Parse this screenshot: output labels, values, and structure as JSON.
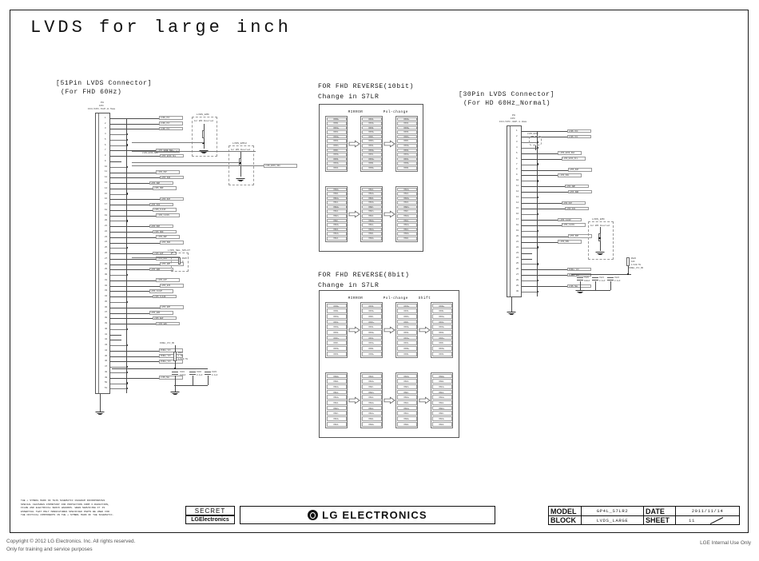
{
  "sheet": {
    "title": "LVDS for large inch"
  },
  "connector_left": {
    "heading_line1": "[51Pin LVDS Connector]",
    "heading_line2": "(For FHD 60Hz)",
    "ref": "P8",
    "part": "FPC",
    "desc": "FFC/FPC-51P-0.5mm",
    "pin_count": 51,
    "pins": [
      {
        "num": "1",
        "net": "LVDS_VCC"
      },
      {
        "num": "2",
        "net": "LVDS_VCC"
      },
      {
        "num": "3",
        "net": "LVDS_VCC"
      },
      {
        "num": "4",
        "net": "GND"
      },
      {
        "num": "5",
        "net": "GND"
      },
      {
        "num": "6",
        "net": "GND"
      },
      {
        "num": "7",
        "net": "LVDS_EDID_SDA"
      },
      {
        "num": "8",
        "net": "LVDS_EDID_SCL"
      },
      {
        "num": "9",
        "net": "NC"
      },
      {
        "num": "10",
        "net": "GND"
      },
      {
        "num": "11",
        "net": "LVDS_OAP"
      },
      {
        "num": "12",
        "net": "LVDS_OAN"
      },
      {
        "num": "13",
        "net": "LVDS_OBP"
      },
      {
        "num": "14",
        "net": "LVDS_OBN"
      },
      {
        "num": "15",
        "net": "GND"
      },
      {
        "num": "16",
        "net": "LVDS_OCP"
      },
      {
        "num": "17",
        "net": "LVDS_OCN"
      },
      {
        "num": "18",
        "net": "LVDS_CLK1P"
      },
      {
        "num": "19",
        "net": "LVDS_CLK1N"
      },
      {
        "num": "20",
        "net": "GND"
      },
      {
        "num": "21",
        "net": "LVDS_ODP"
      },
      {
        "num": "22",
        "net": "LVDS_ODN"
      },
      {
        "num": "23",
        "net": "LVDS_OEP"
      },
      {
        "num": "24",
        "net": "LVDS_OEN"
      },
      {
        "num": "25",
        "net": "GND"
      },
      {
        "num": "26",
        "net": "LVDS_EAP"
      },
      {
        "num": "27",
        "net": "LVDS_EAN"
      },
      {
        "num": "28",
        "net": "LVDS_EBP"
      },
      {
        "num": "29",
        "net": "LVDS_EBN"
      },
      {
        "num": "30",
        "net": "GND"
      },
      {
        "num": "31",
        "net": "LVDS_ECP"
      },
      {
        "num": "32",
        "net": "LVDS_ECN"
      },
      {
        "num": "33",
        "net": "LVDS_CLK2P"
      },
      {
        "num": "34",
        "net": "LVDS_CLK2N"
      },
      {
        "num": "35",
        "net": "GND"
      },
      {
        "num": "36",
        "net": "LVDS_EDP"
      },
      {
        "num": "37",
        "net": "LVDS_EDN"
      },
      {
        "num": "38",
        "net": "LVDS_EEP"
      },
      {
        "num": "39",
        "net": "LVDS_EEN"
      },
      {
        "num": "40",
        "net": "GND"
      },
      {
        "num": "41",
        "net": "NC"
      },
      {
        "num": "42",
        "net": "NC"
      },
      {
        "num": "43",
        "net": "GND"
      },
      {
        "num": "44",
        "net": "PANEL_VCC"
      },
      {
        "num": "45",
        "net": "PANEL_VCC"
      },
      {
        "num": "46",
        "net": "PANEL_VCC"
      },
      {
        "num": "47",
        "net": "GND"
      },
      {
        "num": "48",
        "net": "GND"
      },
      {
        "num": "49",
        "net": "LVDS_SEL"
      },
      {
        "num": "50",
        "net": "GND"
      },
      {
        "num": "51",
        "net": "GND"
      }
    ]
  },
  "connector_right": {
    "heading_line1": "[30Pin LVDS Connector]",
    "heading_line2": "(For HD 60Hz_Normal)",
    "ref": "P9",
    "part": "FPC",
    "desc": "FFC/FPC-30P-1.0mm",
    "pin_count": 30,
    "pins": [
      {
        "num": "1",
        "net": "LVDS_VCC"
      },
      {
        "num": "2",
        "net": "LVDS_VCC"
      },
      {
        "num": "3",
        "net": "GND"
      },
      {
        "num": "4",
        "net": "GND"
      },
      {
        "num": "5",
        "net": "LVDS_EDID_SDA"
      },
      {
        "num": "6",
        "net": "LVDS_EDID_SCL"
      },
      {
        "num": "7",
        "net": "GND"
      },
      {
        "num": "8",
        "net": "LVDS_OAP"
      },
      {
        "num": "9",
        "net": "LVDS_OAN"
      },
      {
        "num": "10",
        "net": "GND"
      },
      {
        "num": "11",
        "net": "LVDS_OBP"
      },
      {
        "num": "12",
        "net": "LVDS_OBN"
      },
      {
        "num": "13",
        "net": "GND"
      },
      {
        "num": "14",
        "net": "LVDS_OCP"
      },
      {
        "num": "15",
        "net": "LVDS_OCN"
      },
      {
        "num": "16",
        "net": "GND"
      },
      {
        "num": "17",
        "net": "LVDS_CLK1P"
      },
      {
        "num": "18",
        "net": "LVDS_CLK1N"
      },
      {
        "num": "19",
        "net": "GND"
      },
      {
        "num": "20",
        "net": "LVDS_ODP"
      },
      {
        "num": "21",
        "net": "LVDS_ODN"
      },
      {
        "num": "22",
        "net": "GND"
      },
      {
        "num": "23",
        "net": "NC"
      },
      {
        "num": "24",
        "net": "NC"
      },
      {
        "num": "25",
        "net": "GND"
      },
      {
        "num": "26",
        "net": "PANEL_VCC"
      },
      {
        "num": "27",
        "net": "PANEL_VCC"
      },
      {
        "num": "28",
        "net": "GND"
      },
      {
        "num": "29",
        "net": "LVDS_SEL"
      },
      {
        "num": "30",
        "net": "GND"
      }
    ]
  },
  "opt_blocks": [
    {
      "label": "LVDS_EMI",
      "note": "For EMI Reserved"
    },
    {
      "label": "LVDS_EMI2",
      "note": "For EMI Reserved"
    },
    {
      "label": "LVDS_EMI",
      "note": "For EMI Reserved"
    }
  ],
  "components": {
    "left_cluster": {
      "resistor": {
        "ref": "R801",
        "value": "1.5K",
        "tol": "1/10W 5%",
        "net": "PANEL_VCC_ON"
      },
      "caps": [
        {
          "ref": "C801",
          "value": "100uF",
          "rating": "16V"
        },
        {
          "ref": "C802",
          "value": "0.1uF",
          "rating": "16V"
        },
        {
          "ref": "C803",
          "value": "0.1uF",
          "rating": "16V"
        }
      ],
      "gnd": "GND"
    },
    "mid_cluster": {
      "label": "LVDS_SEL_SPLIT",
      "resistor": {
        "ref": "R805",
        "value": "0",
        "tol": "1/16W"
      }
    },
    "right_cluster": {
      "resistor": {
        "ref": "R820",
        "value": "10K",
        "tol": "1/16W 5%",
        "net": "PANEL_VCC_ON"
      },
      "caps": [
        {
          "ref": "C820",
          "value": "100uF",
          "rating": "16V"
        },
        {
          "ref": "C821",
          "value": "0.1uF",
          "rating": "16V"
        },
        {
          "ref": "C822",
          "value": "0.1uF",
          "rating": "16V"
        }
      ],
      "gnd": "GND"
    }
  },
  "table_10bit": {
    "heading_line1": "FOR FHD REVERSE(10bit)",
    "heading_line2": "Change in S7LR",
    "col_labels": [
      "MIRROR",
      "Pol-change"
    ],
    "groups": [
      {
        "columns": [
          [
            "RXO0+",
            "RXO0-",
            "RXO1+",
            "RXO1-",
            "RXO2+",
            "RXO2-",
            "RXOC+",
            "RXOC-",
            "RXO3+",
            "RXO3-",
            "RXO4+",
            "RXO4-"
          ],
          [
            "RXO4-",
            "RXO4+",
            "RXO3-",
            "RXO3+",
            "RXOC-",
            "RXOC+",
            "RXO2-",
            "RXO2+",
            "RXO1-",
            "RXO1+",
            "RXO0-",
            "RXO0+"
          ],
          [
            "RXO4+",
            "RXO4-",
            "RXO3+",
            "RXO3-",
            "RXOC+",
            "RXOC-",
            "RXO2+",
            "RXO2-",
            "RXO1+",
            "RXO1-",
            "RXO0+",
            "RXO0-"
          ]
        ]
      },
      {
        "columns": [
          [
            "RXE0+",
            "RXE0-",
            "RXE1+",
            "RXE1-",
            "RXE2+",
            "RXE2-",
            "RXEC+",
            "RXEC-",
            "RXE3+",
            "RXE3-",
            "RXE4+",
            "RXE4-"
          ],
          [
            "RXE4-",
            "RXE4+",
            "RXE3-",
            "RXE3+",
            "RXEC-",
            "RXEC+",
            "RXE2-",
            "RXE2+",
            "RXE1-",
            "RXE1+",
            "RXE0-",
            "RXE0+"
          ],
          [
            "RXE4+",
            "RXE4-",
            "RXE3+",
            "RXE3-",
            "RXEC+",
            "RXEC-",
            "RXE2+",
            "RXE2-",
            "RXE1+",
            "RXE1-",
            "RXE0+",
            "RXE0-"
          ]
        ]
      }
    ]
  },
  "table_8bit": {
    "heading_line1": "FOR FHD REVERSE(8bit)",
    "heading_line2": "Change in S7LR",
    "col_labels": [
      "MIRROR",
      "Pol-change",
      "Shift"
    ],
    "groups": [
      {
        "columns": [
          [
            "RXO0+",
            "RXO0-",
            "RXO1+",
            "RXO1-",
            "RXO2+",
            "RXO2-",
            "RXOC+",
            "RXOC-",
            "RXO3+",
            "RXO3-"
          ],
          [
            "RXO3-",
            "RXO3+",
            "RXOC-",
            "RXOC+",
            "RXO2-",
            "RXO2+",
            "RXO1-",
            "RXO1+",
            "RXO0-",
            "RXO0+"
          ],
          [
            "RXO3+",
            "RXO3-",
            "RXOC+",
            "RXOC-",
            "RXO2+",
            "RXO2-",
            "RXO1+",
            "RXO1-",
            "RXO0+",
            "RXO0-"
          ],
          [
            "RXO0+",
            "RXO0-",
            "RXO1+",
            "RXO1-",
            "RXO2+",
            "RXO2-",
            "RXOC+",
            "RXOC-",
            "RXO3+",
            "RXO3-"
          ]
        ]
      },
      {
        "columns": [
          [
            "RXE0+",
            "RXE0-",
            "RXE1+",
            "RXE1-",
            "RXE2+",
            "RXE2-",
            "RXEC+",
            "RXEC-",
            "RXE3+",
            "RXE3-"
          ],
          [
            "RXE3-",
            "RXE3+",
            "RXEC-",
            "RXEC+",
            "RXE2-",
            "RXE2+",
            "RXE1-",
            "RXE1+",
            "RXE0-",
            "RXE0+"
          ],
          [
            "RXE3+",
            "RXE3-",
            "RXEC+",
            "RXEC-",
            "RXE2+",
            "RXE2-",
            "RXE1+",
            "RXE1-",
            "RXE0+",
            "RXE0-"
          ],
          [
            "RXE0+",
            "RXE0-",
            "RXE1+",
            "RXE1-",
            "RXE2+",
            "RXE2-",
            "RXEC+",
            "RXEC-",
            "RXE3+",
            "RXE3-"
          ]
        ]
      }
    ]
  },
  "title_block": {
    "safety_notice": "THE ⚠ SYMBOL MARK OF THIS SCHEMATIC DIAGRAM INCORPORATES\nSPECIAL FEATURES IMPORTANT FOR PROTECTION FROM X-RADIATION,\nFILRE AND ELECTRICAL SHOCK HAZARDS. WHEN SERVICING IT IS\nESSENTIAL THAT ONLY MANUFATURES SPECIFIED PARTS BE USED FOR\nTHE CRITICAL COMPONENTS IN THE ⚠ SYMBOL MARK OF THE SCHEMATIC.",
    "secret_label": "SECRET",
    "company_small": "LGElectronics",
    "logo_text": "LG ELECTRONICS",
    "model_key": "MODEL",
    "model_value": "GP4L_S7LR2",
    "date_key": "DATE",
    "date_value": "2011/11/14",
    "block_key": "BLOCK",
    "block_value": "LVDS_LARGE",
    "sheet_key": "SHEET",
    "sheet_value": "11"
  },
  "footer": {
    "copyright_line1": "Copyright © 2012 LG Electronics. Inc. All rights reserved.",
    "copyright_line2": "Only for training and service purposes",
    "internal_use": "LGE Internal Use Only"
  }
}
